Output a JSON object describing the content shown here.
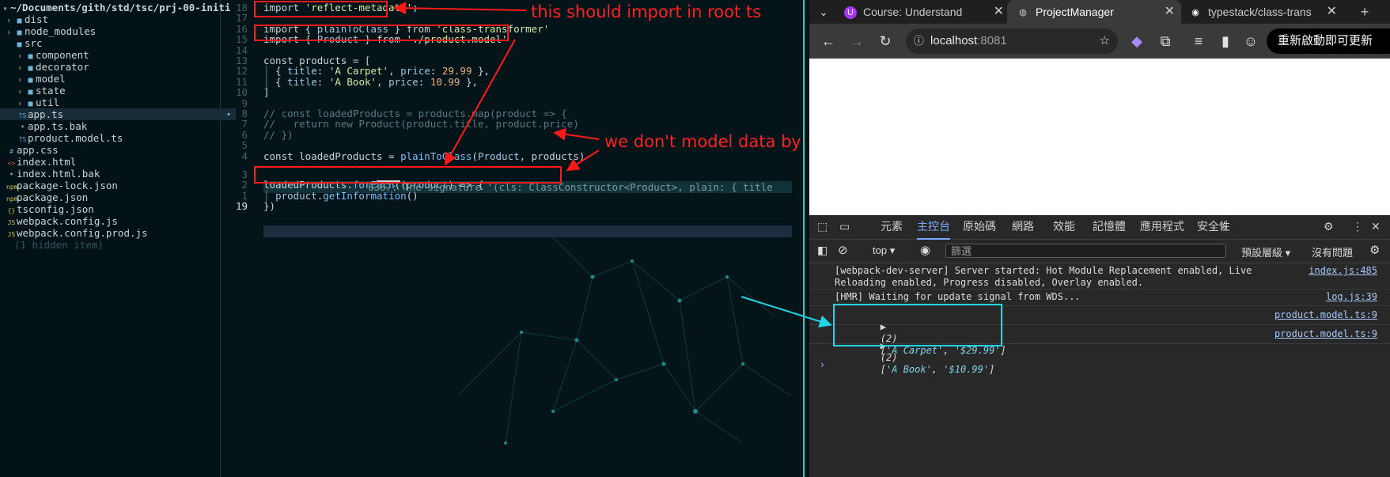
{
  "file_tree": {
    "root_path": "~/Documents/gith/std/tsc/prj-00-initi",
    "items": [
      {
        "label": "dist",
        "kind": "folder",
        "caret": "›"
      },
      {
        "label": "node_modules",
        "kind": "folder",
        "caret": "›"
      },
      {
        "label": "src",
        "kind": "folder-open",
        "caret": ""
      },
      {
        "label": "component",
        "kind": "folder",
        "caret": "›"
      },
      {
        "label": "decorator",
        "kind": "folder",
        "caret": "›"
      },
      {
        "label": "model",
        "kind": "folder",
        "caret": "›"
      },
      {
        "label": "state",
        "kind": "folder",
        "caret": "›"
      },
      {
        "label": "util",
        "kind": "folder",
        "caret": "›"
      },
      {
        "label": "app.ts",
        "kind": "ts",
        "icon": "TS",
        "selected": true
      },
      {
        "label": "app.ts.bak",
        "kind": "file",
        "icon": "*"
      },
      {
        "label": "product.model.ts",
        "kind": "ts",
        "icon": "TS"
      },
      {
        "label": "app.css",
        "kind": "css",
        "icon": "#"
      },
      {
        "label": "index.html",
        "kind": "html",
        "icon": "<>"
      },
      {
        "label": "index.html.bak",
        "kind": "file",
        "icon": "*"
      },
      {
        "label": "package-lock.json",
        "kind": "json",
        "icon": "npm"
      },
      {
        "label": "package.json",
        "kind": "json",
        "icon": "npm"
      },
      {
        "label": "tsconfig.json",
        "kind": "json",
        "icon": "{}"
      },
      {
        "label": "webpack.config.js",
        "kind": "js",
        "icon": "JS"
      },
      {
        "label": "webpack.config.prod.js",
        "kind": "js",
        "icon": "JS"
      },
      {
        "label": "(1 hidden item)",
        "kind": "hint"
      }
    ]
  },
  "editor": {
    "line_numbers": [
      "18",
      "17",
      "16",
      "15",
      "14",
      "13",
      "12",
      "11",
      "10",
      "9",
      "8",
      "7",
      "6",
      "5",
      "4",
      "3",
      "2",
      "1",
      "19"
    ],
    "lines": [
      {
        "parts": [
          [
            "kw",
            "import "
          ],
          [
            "str",
            "'reflect-metadata'"
          ],
          [
            "kw",
            ";"
          ]
        ]
      },
      {
        "parts": []
      },
      {
        "parts": [
          [
            "kw",
            "import { "
          ],
          [
            "prop",
            "plainToClass"
          ],
          [
            "kw",
            " } from "
          ],
          [
            "str",
            "'class-transformer'"
          ]
        ]
      },
      {
        "parts": [
          [
            "kw",
            "import { "
          ],
          [
            "prop",
            "Product"
          ],
          [
            "kw",
            " } from "
          ],
          [
            "str",
            "'./product.model'"
          ]
        ]
      },
      {
        "parts": []
      },
      {
        "parts": [
          [
            "kw",
            "const products = ["
          ]
        ]
      },
      {
        "parts": [
          [
            "cmt",
            "│ "
          ],
          [
            "kw",
            "{ "
          ],
          [
            "prop",
            "title"
          ],
          [
            "kw",
            ": "
          ],
          [
            "str",
            "'A Carpet'"
          ],
          [
            "kw",
            ", "
          ],
          [
            "prop",
            "price"
          ],
          [
            "kw",
            ": "
          ],
          [
            "num",
            "29.99"
          ],
          [
            "kw",
            " },"
          ]
        ]
      },
      {
        "parts": [
          [
            "cmt",
            "│ "
          ],
          [
            "kw",
            "{ "
          ],
          [
            "prop",
            "title"
          ],
          [
            "kw",
            ": "
          ],
          [
            "str",
            "'A Book'"
          ],
          [
            "kw",
            ", "
          ],
          [
            "prop",
            "price"
          ],
          [
            "kw",
            ": "
          ],
          [
            "num",
            "10.99"
          ],
          [
            "kw",
            " },"
          ]
        ]
      },
      {
        "parts": [
          [
            "kw",
            "]"
          ]
        ]
      },
      {
        "parts": []
      },
      {
        "parts": [
          [
            "cmt",
            "// const loadedProducts = products.map(product => {"
          ]
        ]
      },
      {
        "parts": [
          [
            "cmt",
            "//   return new Product(product.title, product.price)"
          ]
        ]
      },
      {
        "parts": [
          [
            "cmt",
            "// })"
          ]
        ]
      },
      {
        "parts": []
      },
      {
        "parts": [
          [
            "kw",
            "const loadedProducts = "
          ],
          [
            "fn",
            "plainToClass"
          ],
          [
            "kw",
            "("
          ],
          [
            "prop",
            "Product"
          ],
          [
            "kw",
            ", products)"
          ]
        ]
      },
      {
        "parts": []
      },
      {
        "parts": [
          [
            "kw",
            "loadedProducts."
          ],
          [
            "fn",
            "forEach"
          ],
          [
            "kw",
            "(("
          ],
          [
            "prop",
            "product"
          ],
          [
            "kw",
            ") => {"
          ]
        ]
      },
      {
        "parts": [
          [
            "cmt",
            "│ "
          ],
          [
            "prop",
            "product"
          ],
          [
            "kw",
            "."
          ],
          [
            "fn",
            "getInformation"
          ],
          [
            "kw",
            "()"
          ]
        ]
      },
      {
        "parts": [
          [
            "kw",
            "})"
          ]
        ]
      }
    ],
    "diagnostic": "6387: The signature '(cls: ClassConstructor<Product>, plain: { title"
  },
  "annotations": {
    "root_note": "this should import in root ts",
    "model_note": "we don't model data by ourselve now"
  },
  "browser": {
    "tabs": [
      {
        "title": "Course: Understand",
        "icon": "U",
        "active": false
      },
      {
        "title": "ProjectManager",
        "icon": "◍",
        "active": true
      },
      {
        "title": "typestack/class-trans",
        "icon": "◉",
        "active": false
      }
    ],
    "new_tab": "+",
    "url_host": "localhost",
    "url_port": ":8081",
    "relaunch_label": "重新啟動即可更新",
    "devtools": {
      "tabs": [
        "元素",
        "主控台",
        "原始碼",
        "網路",
        "效能",
        "記憶體",
        "應用程式",
        "安全性"
      ],
      "active_tab": "主控台",
      "context": "top",
      "filter_placeholder": "篩選",
      "levels": "預設層級",
      "issues": "沒有問題",
      "messages": [
        {
          "text": "[webpack-dev-server] Server started: Hot Module Replacement enabled, Live\nReloading enabled, Progress disabled, Overlay enabled.",
          "source": "index.js:485"
        },
        {
          "text": "[HMR] Waiting for update signal from WDS...",
          "source": "log.js:39"
        },
        {
          "count": "(2)",
          "values": [
            "'A Carpet'",
            "'$29.99'"
          ],
          "source": "product.model.ts:9"
        },
        {
          "count": "(2)",
          "values": [
            "'A Book'",
            "'$10.99'"
          ],
          "source": "product.model.ts:9"
        }
      ],
      "prompt": "›"
    }
  },
  "colors": {
    "annotation_red": "#ff1a1a",
    "highlight_cyan": "#22d3e6",
    "split_accent": "#2fd0c0"
  }
}
